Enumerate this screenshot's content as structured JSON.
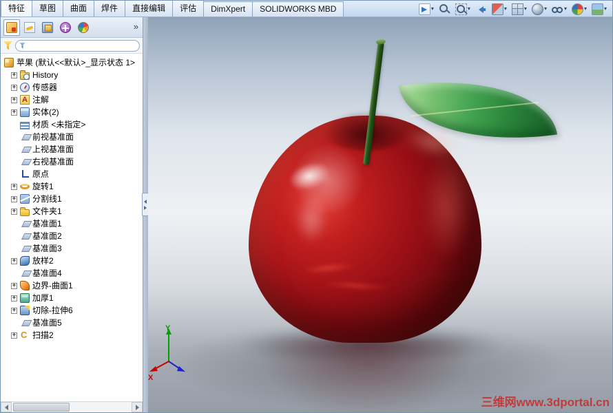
{
  "ribbon": {
    "dropdown_glyph": "▾",
    "tabs": [
      {
        "id": "features",
        "label": "特征",
        "active": true
      },
      {
        "id": "sketch",
        "label": "草图",
        "active": false
      },
      {
        "id": "surfaces",
        "label": "曲面",
        "active": false
      },
      {
        "id": "weldments",
        "label": "焊件",
        "active": false
      },
      {
        "id": "direct-editing",
        "label": "直接编辑",
        "active": false
      },
      {
        "id": "evaluate",
        "label": "评估",
        "active": false
      },
      {
        "id": "dimxpert",
        "label": "DimXpert",
        "active": false
      },
      {
        "id": "solidworks-mbd",
        "label": "SOLIDWORKS MBD",
        "active": false
      }
    ],
    "view_toolbar": [
      {
        "name": "3d-views-icon",
        "dropdown": true
      },
      {
        "name": "zoom-fit-icon",
        "dropdown": false
      },
      {
        "name": "zoom-area-icon",
        "dropdown": true
      },
      {
        "name": "previous-view-icon",
        "dropdown": false
      },
      {
        "name": "section-view-icon",
        "dropdown": true
      },
      {
        "name": "view-orientation-icon",
        "dropdown": true
      },
      {
        "name": "display-style-icon",
        "dropdown": true
      },
      {
        "name": "hide-show-items-icon",
        "dropdown": true
      },
      {
        "name": "edit-appearance-icon",
        "dropdown": true
      },
      {
        "name": "apply-scene-icon",
        "dropdown": true
      }
    ]
  },
  "panel": {
    "overflow_label": "»",
    "filter_placeholder": "",
    "manager_tabs": [
      {
        "name": "featuremanager-tab-icon",
        "active": true
      },
      {
        "name": "propertymanager-tab-icon",
        "active": false
      },
      {
        "name": "configurationmanager-tab-icon",
        "active": false
      },
      {
        "name": "dimxpertmanager-tab-icon",
        "active": false
      },
      {
        "name": "displaymanager-tab-icon",
        "active": false
      }
    ]
  },
  "tree": {
    "expand_glyph": "+",
    "root": {
      "label": "苹果 (默认<<默认>_显示状态 1>",
      "icon": "part-icon"
    },
    "items": [
      {
        "label": "History",
        "icon": "history-icon",
        "expandable": true
      },
      {
        "label": "传感器",
        "icon": "sensors-icon",
        "expandable": true
      },
      {
        "label": "注解",
        "icon": "annotations-icon",
        "expandable": true
      },
      {
        "label": "实体(2)",
        "icon": "solid-bodies-icon",
        "expandable": true
      },
      {
        "label": "材质 <未指定>",
        "icon": "material-icon",
        "expandable": false
      },
      {
        "label": "前视基准面",
        "icon": "plane-icon",
        "expandable": false
      },
      {
        "label": "上视基准面",
        "icon": "plane-icon",
        "expandable": false
      },
      {
        "label": "右视基准面",
        "icon": "plane-icon",
        "expandable": false
      },
      {
        "label": "原点",
        "icon": "origin-icon",
        "expandable": false
      },
      {
        "label": "旋转1",
        "icon": "revolve-icon",
        "expandable": true
      },
      {
        "label": "分割线1",
        "icon": "split-line-icon",
        "expandable": true
      },
      {
        "label": "文件夹1",
        "icon": "folder-icon",
        "expandable": true
      },
      {
        "label": "基准面1",
        "icon": "plane-icon",
        "expandable": false
      },
      {
        "label": "基准面2",
        "icon": "plane-icon",
        "expandable": false
      },
      {
        "label": "基准面3",
        "icon": "plane-icon",
        "expandable": false
      },
      {
        "label": "放样2",
        "icon": "loft-icon",
        "expandable": true
      },
      {
        "label": "基准面4",
        "icon": "plane-icon",
        "expandable": false
      },
      {
        "label": "边界-曲面1",
        "icon": "boundary-surface-icon",
        "expandable": true
      },
      {
        "label": "加厚1",
        "icon": "thicken-icon",
        "expandable": true
      },
      {
        "label": "切除-拉伸6",
        "icon": "cut-extrude-icon",
        "expandable": true
      },
      {
        "label": "基准面5",
        "icon": "plane-icon",
        "expandable": false
      },
      {
        "label": "扫描2",
        "icon": "sweep-icon",
        "expandable": true
      }
    ]
  },
  "viewport": {
    "model": "red apple with green leaf and stem",
    "watermark": "三维网www.3dportal.cn",
    "triad": {
      "x_label": "X",
      "y_label": "Y"
    }
  },
  "colors": {
    "watermark": "#c23b3b",
    "apple_body": "#9a1016",
    "leaf": "#44a452",
    "triad_x": "#cc0000",
    "triad_y": "#00a000",
    "triad_z": "#2020cc"
  }
}
